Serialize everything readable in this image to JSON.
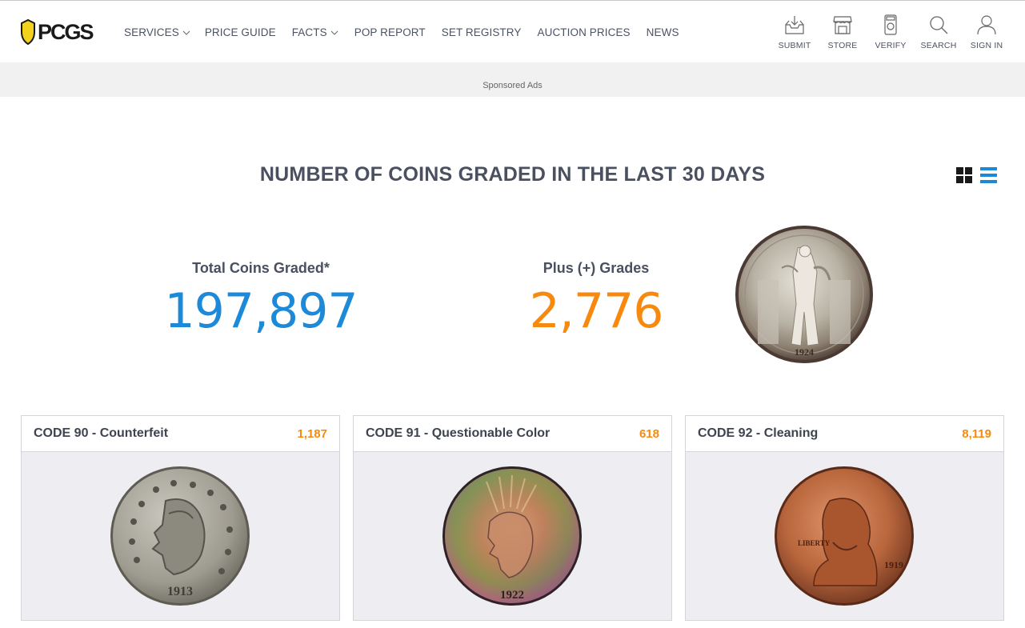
{
  "brand": {
    "logo_text": "PCGS",
    "accent": "#f2d21b"
  },
  "nav": {
    "items": [
      {
        "label": "SERVICES",
        "dropdown": true
      },
      {
        "label": "PRICE GUIDE",
        "dropdown": false
      },
      {
        "label": "FACTS",
        "dropdown": true
      },
      {
        "label": "POP REPORT",
        "dropdown": false
      },
      {
        "label": "SET REGISTRY",
        "dropdown": false
      },
      {
        "label": "AUCTION PRICES",
        "dropdown": false
      },
      {
        "label": "NEWS",
        "dropdown": false
      }
    ]
  },
  "utility": {
    "items": [
      {
        "label": "SUBMIT",
        "icon": "inbox-download-icon"
      },
      {
        "label": "STORE",
        "icon": "storefront-icon"
      },
      {
        "label": "VERIFY",
        "icon": "coin-holder-icon"
      },
      {
        "label": "SEARCH",
        "icon": "search-icon"
      },
      {
        "label": "SIGN IN",
        "icon": "user-icon"
      }
    ]
  },
  "ads": {
    "label": "Sponsored Ads"
  },
  "page": {
    "title": "NUMBER OF COINS GRADED IN THE LAST 30 DAYS"
  },
  "stats": {
    "total": {
      "label": "Total Coins Graded*",
      "value": "197,897",
      "color": "#1c8ad8"
    },
    "plus": {
      "label": "Plus (+) Grades",
      "value": "2,776",
      "color": "#f7890e"
    }
  },
  "cards": [
    {
      "title": "CODE 90 - Counterfeit",
      "count": "1,187",
      "coin": "liberty-nickel"
    },
    {
      "title": "CODE 91 - Questionable Color",
      "count": "618",
      "coin": "peace-dollar"
    },
    {
      "title": "CODE 92 - Cleaning",
      "count": "8,119",
      "coin": "lincoln-cent"
    }
  ],
  "coin_dates": {
    "nickel": "1913",
    "peace": "1922",
    "cent": "1919",
    "quarter": "1924"
  },
  "colors": {
    "blue": "#1c8ad8",
    "orange": "#f7890e",
    "text": "#4a5060"
  }
}
